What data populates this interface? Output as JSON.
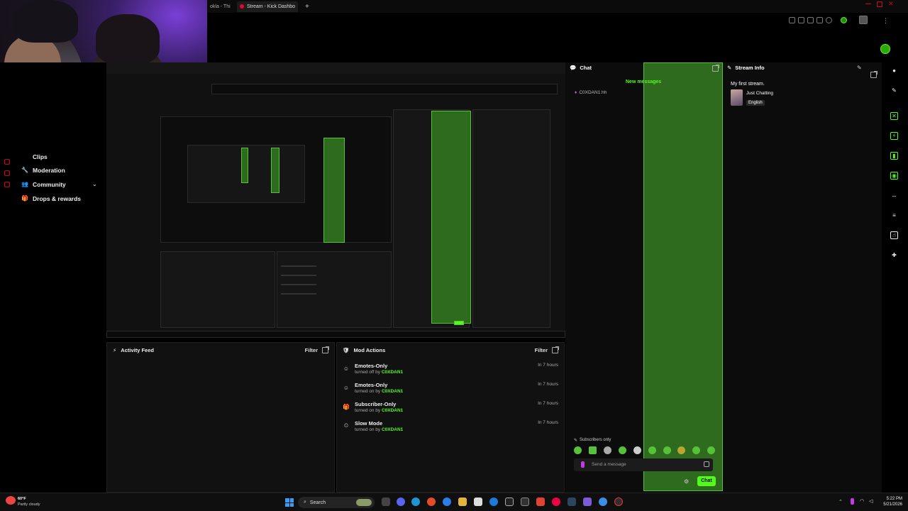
{
  "browser": {
    "tabs": [
      {
        "label": "okla - Thi",
        "active": false
      },
      {
        "label": "Stream - Kick Dashbo",
        "active": true
      }
    ],
    "new_tab": "+"
  },
  "sidebar": {
    "items": [
      {
        "label": "Clips",
        "icon": "clips-icon"
      },
      {
        "label": "Moderation",
        "icon": "wrench-icon"
      },
      {
        "label": "Community",
        "icon": "community-icon"
      },
      {
        "label": "Drops & rewards",
        "icon": "gift-icon"
      }
    ]
  },
  "activity_feed": {
    "title": "Activity Feed",
    "filter_label": "Filter"
  },
  "mod_actions": {
    "title": "Mod Actions",
    "filter_label": "Filter",
    "rows": [
      {
        "title": "Emotes-Only",
        "action": "turned off by",
        "user": "C0XDAN1",
        "time": "In 7 hours",
        "icon": "emote-icon"
      },
      {
        "title": "Emotes-Only",
        "action": "turned on by",
        "user": "C0XDAN1",
        "time": "In 7 hours",
        "icon": "emote-icon"
      },
      {
        "title": "Subscriber-Only",
        "action": "turned on by",
        "user": "C0XDAN1",
        "time": "In 7 hours",
        "icon": "gift-icon"
      },
      {
        "title": "Slow Mode",
        "action": "turned on by",
        "user": "C0XDAN1",
        "time": "In 7 hours",
        "icon": "slow-icon"
      }
    ]
  },
  "chat": {
    "title": "Chat",
    "new_messages": "New messages",
    "message_user": "C0XDAN1:hh",
    "subscribers_only": "Subscribers only",
    "input_placeholder": "Send a message",
    "send_label": "Chat",
    "accent": "#53fc18"
  },
  "stream_info": {
    "title": "Stream Info",
    "stream_title": "My first stream.",
    "category": "Just Chatting",
    "language": "English"
  },
  "webcam": {
    "label": "Webcam overlay"
  },
  "taskbar": {
    "search_label": "Search",
    "weather_temp": "60°F",
    "weather_desc": "Partly cloudy",
    "time": "5:22 PM",
    "date": "5/21/2026"
  }
}
